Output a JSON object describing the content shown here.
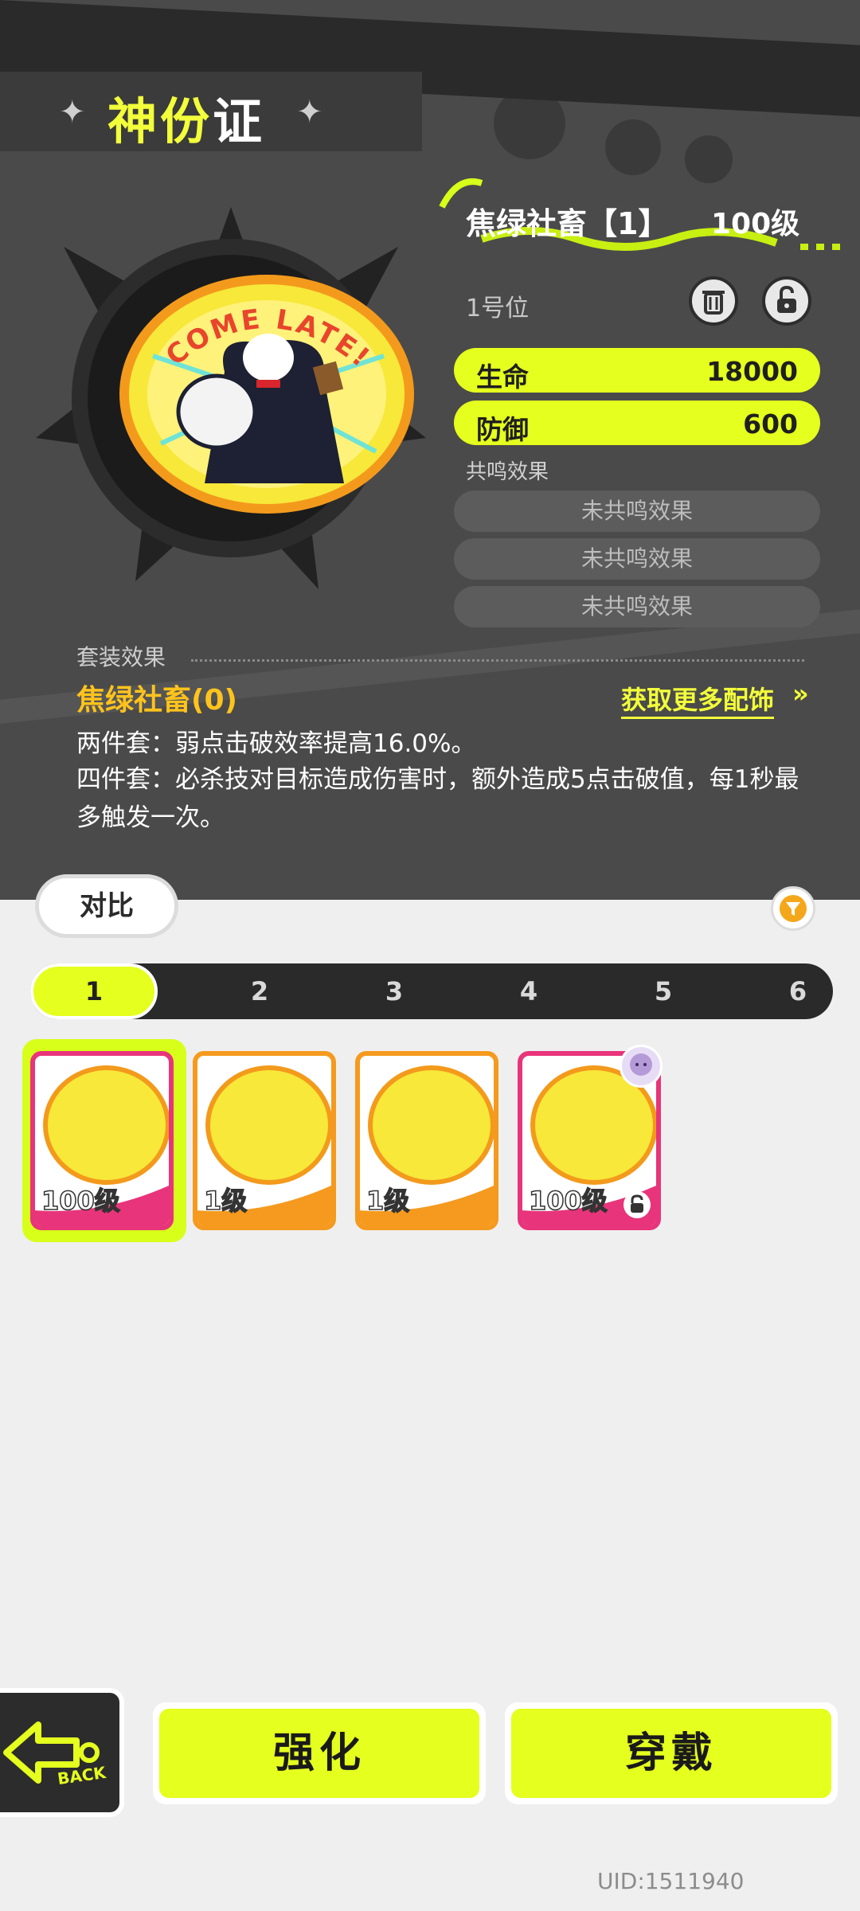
{
  "header": {
    "title_part1": "神份",
    "title_part2": "证"
  },
  "item": {
    "name": "焦绿社畜【1】",
    "level": "100级",
    "slot": "1号位",
    "badge_text": "COME LATE!",
    "stats": [
      {
        "label": "生命",
        "value": "18000"
      },
      {
        "label": "防御",
        "value": "600"
      }
    ],
    "resonance_title": "共鸣效果",
    "resonance": [
      "未共鸣效果",
      "未共鸣效果",
      "未共鸣效果"
    ]
  },
  "set_effect": {
    "title": "套装效果",
    "name": "焦绿社畜(0)",
    "get_more": "获取更多配饰",
    "get_more_arrow": "»",
    "descriptions": [
      "两件套：弱点击破效率提高16.0%。",
      "四件套：必杀技对目标造成伤害时，额外造成5点击破值，每1秒最多触发一次。"
    ]
  },
  "controls": {
    "compare": "对比"
  },
  "tabs": {
    "items": [
      "1",
      "2",
      "3",
      "4",
      "5",
      "6"
    ],
    "active_index": 0
  },
  "inventory": {
    "cards": [
      {
        "level": "100级",
        "rarity_color": "#e8347a",
        "selected": true,
        "locked": false,
        "equipped_avatar": false
      },
      {
        "level": "1级",
        "rarity_color": "#f59a1e",
        "selected": false,
        "locked": false,
        "equipped_avatar": false
      },
      {
        "level": "1级",
        "rarity_color": "#f59a1e",
        "selected": false,
        "locked": false,
        "equipped_avatar": false
      },
      {
        "level": "100级",
        "rarity_color": "#e8347a",
        "selected": false,
        "locked": true,
        "equipped_avatar": true
      }
    ]
  },
  "footer": {
    "back_label": "BACK",
    "enhance": "强化",
    "equip": "穿戴",
    "uid": "UID:1511940"
  },
  "colors": {
    "accent": "#e5ff1e",
    "panel": "#4a4a4a",
    "set_name": "#ffc31c"
  }
}
